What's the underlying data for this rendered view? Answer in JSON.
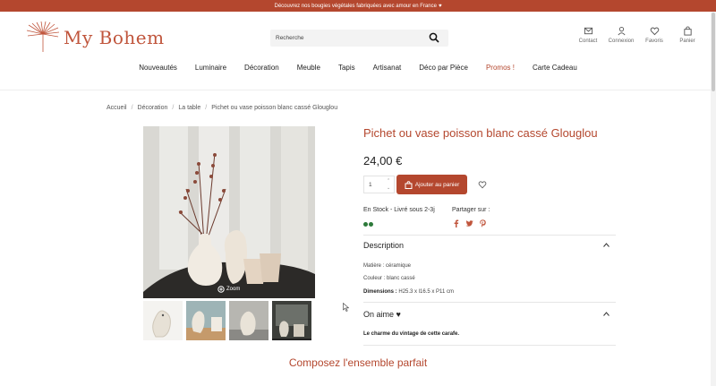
{
  "announcement": {
    "text": "Découvrez nos bougies végétales fabriquées avec amour en France",
    "heart": "♥"
  },
  "brand": {
    "name": "My Bohem",
    "accent": "#b4472e"
  },
  "search": {
    "placeholder": "Recherche"
  },
  "header_links": [
    {
      "label": "Contact",
      "icon": "mail-icon"
    },
    {
      "label": "Connexion",
      "icon": "user-icon"
    },
    {
      "label": "Favoris",
      "icon": "heart-icon"
    },
    {
      "label": "Panier",
      "icon": "bag-icon"
    }
  ],
  "nav": [
    "Nouveautés",
    "Luminaire",
    "Décoration",
    "Meuble",
    "Tapis",
    "Artisanat",
    "Déco par Pièce",
    "Promos !",
    "Carte Cadeau"
  ],
  "breadcrumb": [
    "Accueil",
    "Décoration",
    "La table",
    "Pichet ou vase poisson blanc cassé Glouglou"
  ],
  "gallery": {
    "zoom_label": "Zoom"
  },
  "product": {
    "title": "Pichet ou vase poisson blanc cassé Glouglou",
    "price": "24,00 €",
    "quantity": "1",
    "add_to_cart": "Ajouter au panier",
    "stock": "En Stock - Livré sous 2-3j",
    "share_label": "Partager sur :",
    "social_icons": [
      "facebook-icon",
      "twitter-icon",
      "pinterest-icon"
    ]
  },
  "description": {
    "title": "Description",
    "material": "Matière : céramique",
    "color": "Couleur : blanc cassé",
    "dimensions_label": "Dimensions :",
    "dimensions_value": "H25.3 x l16.5 x P11 cm"
  },
  "on_aime": {
    "title": "On aime ♥",
    "text": "Le charme du vintage de cette carafe."
  },
  "section": {
    "title": "Composez l'ensemble parfait"
  }
}
